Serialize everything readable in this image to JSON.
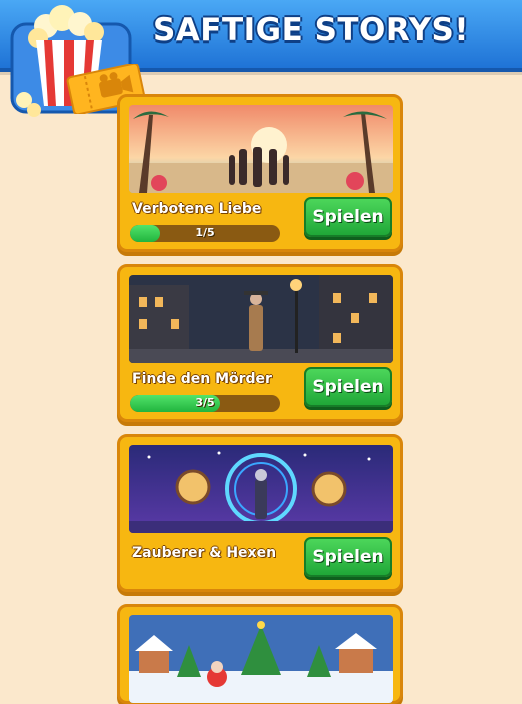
{
  "header": {
    "title": "SAFTIGE STORYS!"
  },
  "emblem": {
    "icon": "popcorn-ticket-icon",
    "ticket_icon": "movie-camera-icon"
  },
  "stories": [
    {
      "title": "Verbotene Liebe",
      "play_label": "Spielen",
      "progress_text": "1/5",
      "progress": 0.2,
      "image": "beach-couple-sunset"
    },
    {
      "title": "Finde den Mörder",
      "play_label": "Spielen",
      "progress_text": "3/5",
      "progress": 0.6,
      "image": "noir-detective-street"
    },
    {
      "title": "Zauberer & Hexen",
      "play_label": "Spielen",
      "image": "magic-portal-clocks"
    },
    {
      "image": "christmas-village-santa"
    }
  ],
  "colors": {
    "header": "#1f73d6",
    "card": "#f7b711",
    "button": "#20a738",
    "background": "#fbe8cc"
  }
}
